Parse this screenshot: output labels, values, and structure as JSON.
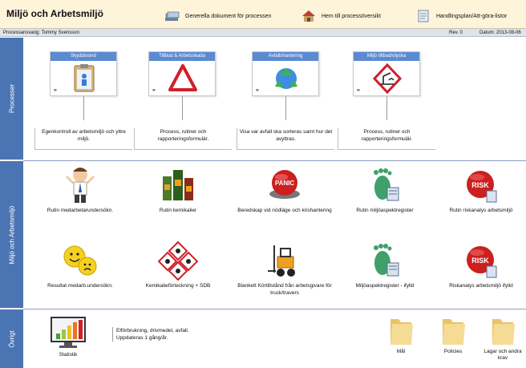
{
  "header": {
    "title": "Miljö och Arbetsmiljö",
    "links": [
      {
        "label": "Generella dokument för processen",
        "icon": "documents-icon"
      },
      {
        "label": "Hem till processöversikt",
        "icon": "home-icon"
      },
      {
        "label": "Handlingsplan/Att-göra-listor",
        "icon": "checklist-icon"
      }
    ]
  },
  "meta": {
    "owner": "Processansvarig: Tommy Svensson",
    "revision": "Rev. 0",
    "date": "Datum: 2013-08-06"
  },
  "bands": {
    "processer": "Processer",
    "miljo": "Miljö och Arbetsmiljö",
    "ovrigt": "Övrigt"
  },
  "processes": [
    {
      "title": "Skyddsrond",
      "icon": "clipboard-icon",
      "description": "Egenkontroll av arbetsmiljö och yttre miljö."
    },
    {
      "title": "Tillbud & Arbetsskada",
      "icon": "warning-triangle-icon",
      "description": "Process, rutiner och rapporteringsformulär."
    },
    {
      "title": "Avfallshantering",
      "icon": "recycle-icon",
      "description": "Visa var avfall ska sorteras samt hur det avyttras."
    },
    {
      "title": "Miljö tillbud/olycka",
      "icon": "hazard-environment-icon",
      "description": "Process, rutiner och rapporteringsformulär."
    }
  ],
  "tiles_row1": [
    {
      "label": "Rutin medarbetarundersökn.",
      "icon": "person-icon"
    },
    {
      "label": "Rutin kemikalier",
      "icon": "chemical-bottles-icon"
    },
    {
      "label": "Beredskap vid nödläge och krishantering",
      "icon": "panic-button-icon",
      "badge": "PANIC"
    },
    {
      "label": "Rutin miljöaspektregister",
      "icon": "footprint-icon"
    },
    {
      "label": "Rutin riskanalys arbetsmiljö",
      "icon": "risk-button-icon",
      "badge": "RISK"
    }
  ],
  "tiles_row2": [
    {
      "label": "Resultat medarb.undersökn.",
      "icon": "smileys-icon"
    },
    {
      "label": "Kemikalieförteckning + SDB",
      "icon": "hazard-symbols-icon"
    },
    {
      "label": "Blankett Körtillstånd från arbetsgivare för truck/travers",
      "icon": "forklift-icon"
    },
    {
      "label": "Miljöaspektregister - ifylld",
      "icon": "footprint-icon"
    },
    {
      "label": "Riskanalys arbetsmiljö ifylld",
      "icon": "risk-button-icon",
      "badge": "RISK"
    }
  ],
  "other": {
    "statistik_label": "Statistik",
    "statistik_text": "Elförbrukning, drivmedel, avfall.",
    "statistik_text2": "Uppdateras 1 gång/år.",
    "folders": [
      "Mål",
      "Policies",
      "Lagar och andra krav"
    ]
  },
  "colors": {
    "band": "#4b74b3",
    "caption": "#5b8ad1",
    "header_bg": "#fdf4da",
    "risk_red": "#cc1f1f",
    "folder": "#f2d27a"
  }
}
